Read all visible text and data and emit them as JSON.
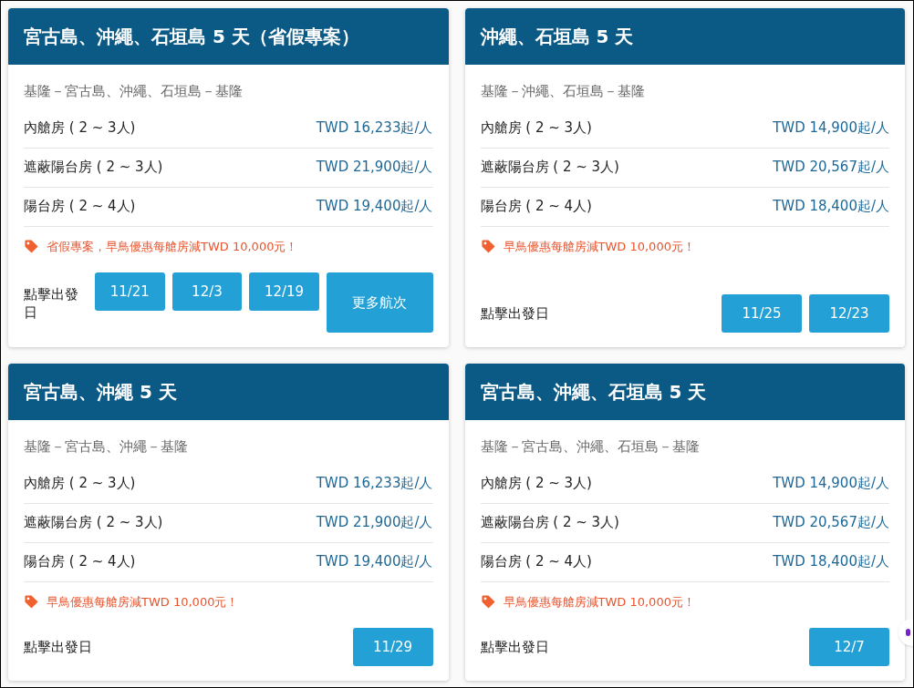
{
  "cards": [
    {
      "title": "宮古島、沖繩、石垣島 5 天（省假專案）",
      "route": "基隆－宮古島、沖繩、石垣島－基隆",
      "rooms": [
        {
          "name": "內艙房 ( 2 ~ 3人)",
          "price": "TWD 16,233起/人"
        },
        {
          "name": "遮蔽陽台房 ( 2 ~ 3人)",
          "price": "TWD 21,900起/人"
        },
        {
          "name": "陽台房 ( 2 ~ 4人)",
          "price": "TWD 19,400起/人"
        }
      ],
      "promo": "省假專案，早鳥優惠每艙房減TWD 10,000元！",
      "departure_label": "點擊出發日",
      "dates": [
        "11/21",
        "12/3",
        "12/19",
        "更多航次"
      ]
    },
    {
      "title": "沖繩、石垣島 5 天",
      "route": "基隆－沖繩、石垣島－基隆",
      "rooms": [
        {
          "name": "內艙房 ( 2 ~ 3人)",
          "price": "TWD 14,900起/人"
        },
        {
          "name": "遮蔽陽台房 ( 2 ~ 3人)",
          "price": "TWD 20,567起/人"
        },
        {
          "name": "陽台房 ( 2 ~ 4人)",
          "price": "TWD 18,400起/人"
        }
      ],
      "promo": "早鳥優惠每艙房減TWD 10,000元！",
      "departure_label": "點擊出發日",
      "dates": [
        "11/25",
        "12/23"
      ]
    },
    {
      "title": "宮古島、沖繩 5 天",
      "route": "基隆－宮古島、沖繩－基隆",
      "rooms": [
        {
          "name": "內艙房 ( 2 ~ 3人)",
          "price": "TWD 16,233起/人"
        },
        {
          "name": "遮蔽陽台房 ( 2 ~ 3人)",
          "price": "TWD 21,900起/人"
        },
        {
          "name": "陽台房 ( 2 ~ 4人)",
          "price": "TWD 19,400起/人"
        }
      ],
      "promo": "早鳥優惠每艙房減TWD 10,000元！",
      "departure_label": "點擊出發日",
      "dates": [
        "11/29"
      ]
    },
    {
      "title": "宮古島、沖繩、石垣島 5 天",
      "route": "基隆－宮古島、沖繩、石垣島－基隆",
      "rooms": [
        {
          "name": "內艙房 ( 2 ~ 3人)",
          "price": "TWD 14,900起/人"
        },
        {
          "name": "遮蔽陽台房 ( 2 ~ 3人)",
          "price": "TWD 20,567起/人"
        },
        {
          "name": "陽台房 ( 2 ~ 4人)",
          "price": "TWD 18,400起/人"
        }
      ],
      "promo": "早鳥優惠每艙房減TWD 10,000元！",
      "departure_label": "點擊出發日",
      "dates": [
        "12/7"
      ]
    }
  ]
}
